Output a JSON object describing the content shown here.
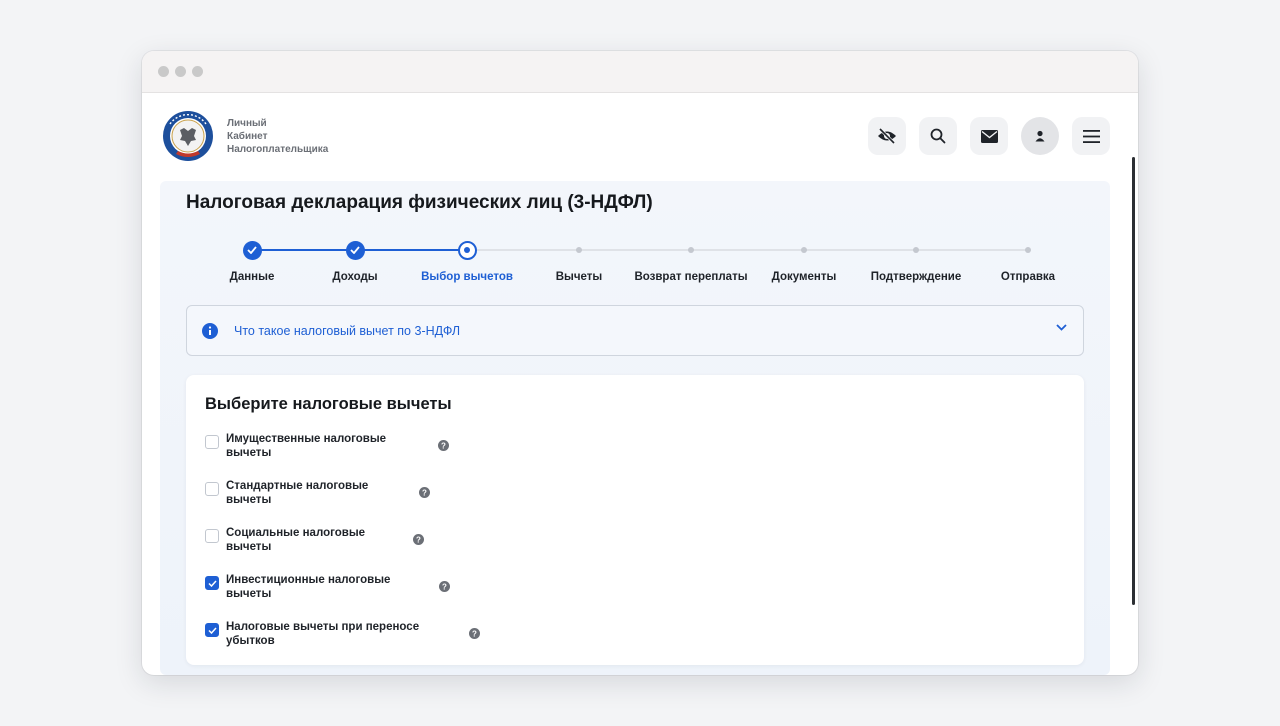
{
  "brand": {
    "line1": "Личный",
    "line2": "Кабинет",
    "line3": "Налогоплательщика"
  },
  "header": {
    "icons": [
      "eye-off-icon",
      "search-icon",
      "mail-icon",
      "user-icon",
      "menu-icon"
    ]
  },
  "page": {
    "title": "Налоговая декларация физических лиц (3-НДФЛ)"
  },
  "steps": [
    {
      "label": "Данные",
      "state": "done"
    },
    {
      "label": "Доходы",
      "state": "done"
    },
    {
      "label": "Выбор вычетов",
      "state": "current"
    },
    {
      "label": "Вычеты",
      "state": "future"
    },
    {
      "label": "Возврат переплаты",
      "state": "future"
    },
    {
      "label": "Документы",
      "state": "future"
    },
    {
      "label": "Подтверждение",
      "state": "future"
    },
    {
      "label": "Отправка",
      "state": "future"
    }
  ],
  "info": {
    "text": "Что такое налоговый вычет по 3-НДФЛ"
  },
  "deductions": {
    "title": "Выберите налоговые вычеты",
    "options": [
      {
        "line1": "Имущественные налоговые",
        "line2": "вычеты",
        "checked": false
      },
      {
        "line1": "Стандартные налоговые",
        "line2": "вычеты",
        "checked": false
      },
      {
        "line1": "Социальные налоговые",
        "line2": "вычеты",
        "checked": false
      },
      {
        "line1": "Инвестиционные налоговые",
        "line2": "вычеты",
        "checked": true
      },
      {
        "line1": "Налоговые вычеты при переносе",
        "line2": "убытков",
        "checked": true
      }
    ]
  },
  "colors": {
    "accent": "#1e5fd4",
    "text": "#1f2329",
    "muted": "#6b6f76"
  }
}
